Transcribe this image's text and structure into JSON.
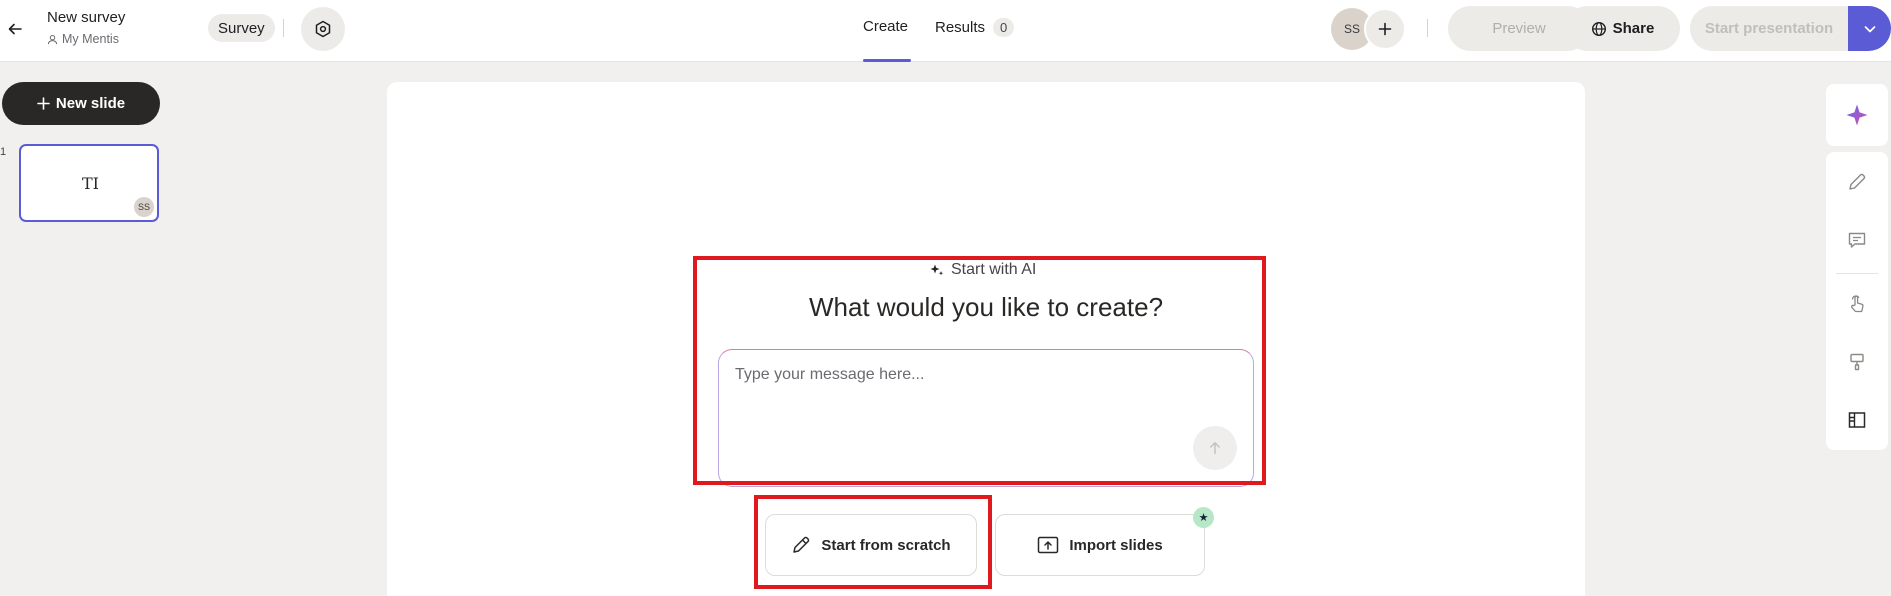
{
  "header": {
    "title": "New survey",
    "workspace": "My Mentis",
    "type_badge": "Survey",
    "tabs": [
      {
        "label": "Create"
      },
      {
        "label": "Results",
        "count": "0"
      }
    ],
    "avatar_initials": "SS",
    "preview_label": "Preview",
    "share_label": "Share",
    "start_presentation_label": "Start presentation"
  },
  "sidebar": {
    "new_slide_label": "New slide",
    "slides": [
      {
        "number": "1",
        "icon_text": "TI",
        "avatar": "SS"
      }
    ]
  },
  "canvas": {
    "ai_label": "Start with AI",
    "heading": "What would you like to create?",
    "message_placeholder": "Type your message here...",
    "start_from_scratch_label": "Start from scratch",
    "import_slides_label": "Import slides",
    "new_marker": "★"
  },
  "colors": {
    "accent": "#5b5bd6",
    "highlight": "#e0191f",
    "dark_button": "#2a2826"
  }
}
